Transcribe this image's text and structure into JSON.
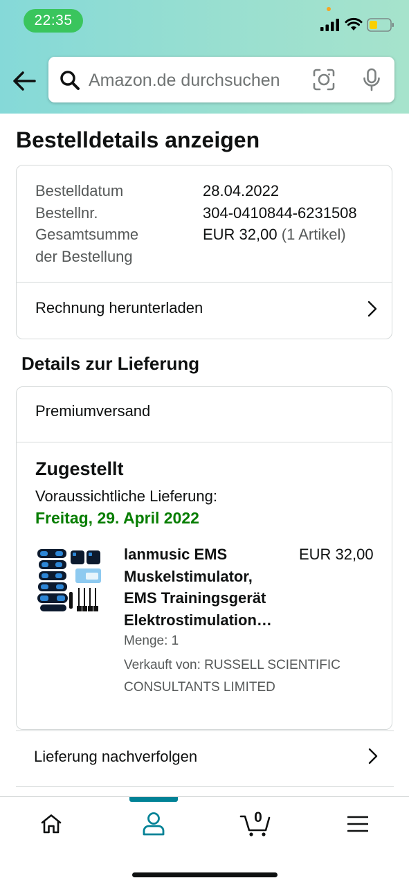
{
  "status_bar": {
    "time": "22:35"
  },
  "search": {
    "placeholder": "Amazon.de durchsuchen"
  },
  "page": {
    "title": "Bestelldetails anzeigen"
  },
  "order_summary": {
    "rows": [
      {
        "label": "Bestelldatum",
        "value": "28.04.2022"
      },
      {
        "label": "Bestellnr.",
        "value": "304-0410844-6231508"
      },
      {
        "label_line1": "Gesamtsumme",
        "label_line2": "der Bestellung",
        "value": "EUR 32,00",
        "value_note": "(1 Artikel)"
      }
    ],
    "invoice_link": "Rechnung herunterladen"
  },
  "delivery": {
    "section_title": "Details zur Lieferung",
    "shipping_method": "Premiumversand",
    "status": "Zugestellt",
    "eta_label": "Voraussichtliche Lieferung:",
    "eta_date": "Freitag, 29. April 2022",
    "status_color": "#067d00",
    "item": {
      "title": "lanmusic EMS Muskelstimulator, EMS Trainingsgerät Elektrostimulation…",
      "title_lines": [
        "lanmusic EMS",
        "Muskelstimulator,",
        "EMS Trainingsgerät",
        "Elektrostimulation…"
      ],
      "price": "EUR 32,00",
      "quantity": "Menge: 1",
      "seller_line1": "Verkauft von: RUSSELL SCIENTIFIC",
      "seller_line2": "CONSULTANTS LIMITED",
      "image_icon": "ems-muscle-stimulator-product-image"
    },
    "track_link": "Lieferung nachverfolgen"
  },
  "bottom_nav": {
    "items": [
      {
        "name": "home",
        "icon": "home-icon"
      },
      {
        "name": "account",
        "icon": "user-icon",
        "active": true
      },
      {
        "name": "cart",
        "icon": "cart-icon",
        "count": "0"
      },
      {
        "name": "menu",
        "icon": "hamburger-menu-icon"
      }
    ],
    "active_color": "#008296"
  },
  "colors": {
    "header_gradient_start": "#85d9d8",
    "header_gradient_end": "#a6e3cc",
    "time_pill": "#3ac55d"
  }
}
